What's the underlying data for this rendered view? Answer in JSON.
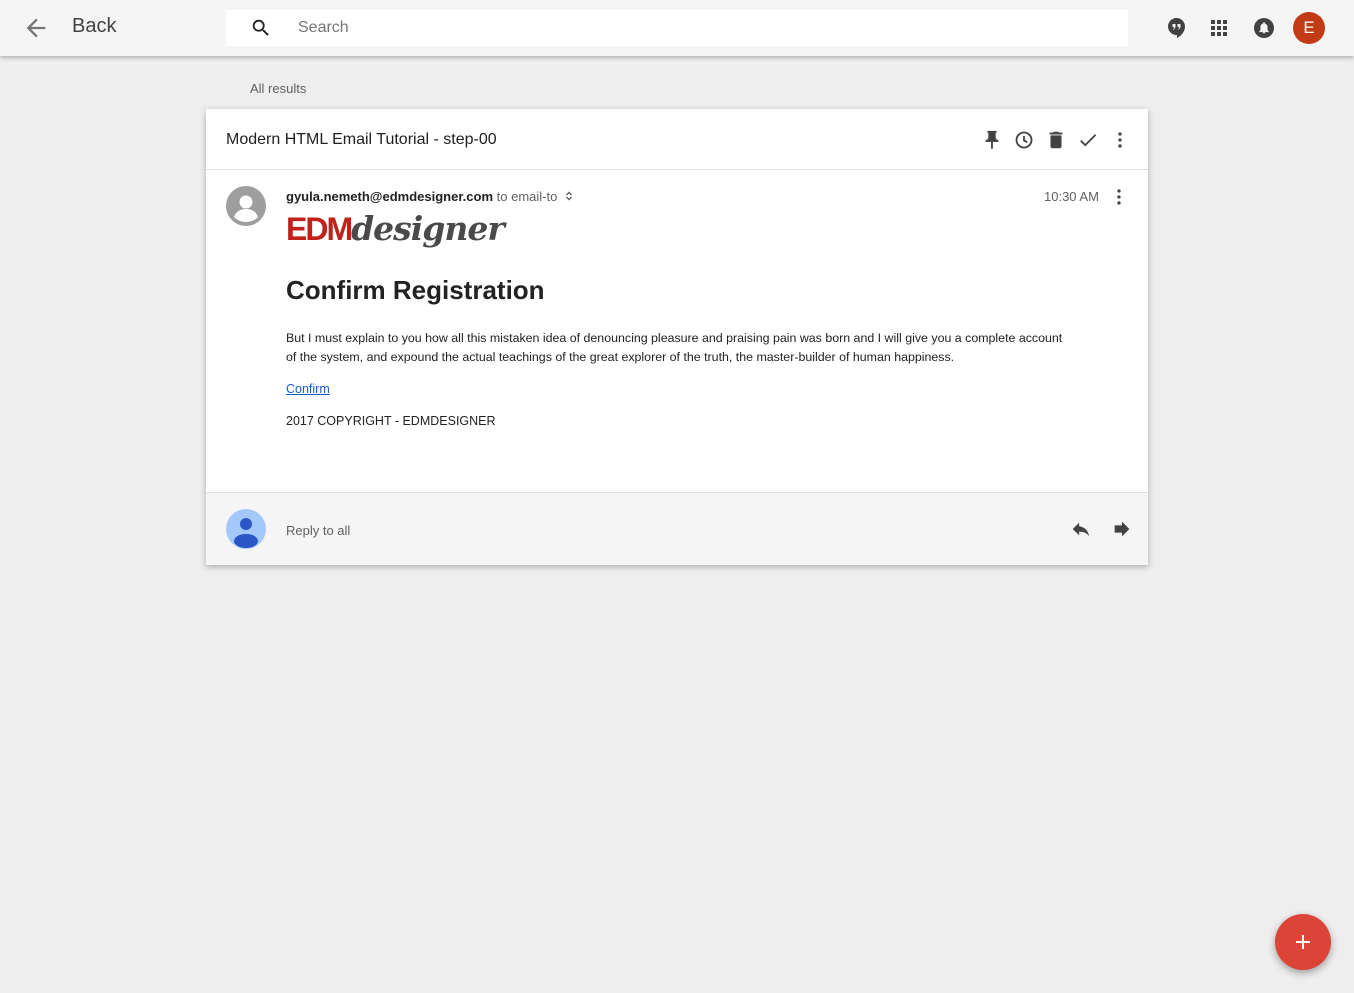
{
  "topbar": {
    "back_label": "Back",
    "search_placeholder": "Search",
    "account_initial": "E",
    "icons": [
      "arrow-back-icon",
      "search-icon",
      "hangouts-icon",
      "apps-grid-icon",
      "notifications-icon"
    ]
  },
  "breadcrumb": {
    "label": "All results"
  },
  "message": {
    "subject": "Modern HTML Email Tutorial - step-00",
    "header_icons": [
      "pin-icon",
      "snooze-clock-icon",
      "trash-icon",
      "done-check-icon",
      "more-vert-icon"
    ],
    "sender_email": "gyula.nemeth@edmdesigner.com",
    "recipient_text": "to email-to",
    "time": "10:30 AM",
    "logo_part1": "EDM",
    "logo_part2": "designer",
    "heading": "Confirm Registration",
    "body": "But I must explain to you how all this mistaken idea of denouncing pleasure and praising pain was born and I will give you a complete account of the system, and expound the actual teachings of the great explorer of the truth, the master-builder of human happiness.",
    "link_text": "Confirm",
    "copyright": "2017 COPYRIGHT - EDMDESIGNER"
  },
  "reply": {
    "label": "Reply to all",
    "icons": [
      "reply-icon",
      "forward-icon"
    ]
  },
  "fab": {
    "icon": "plus-icon"
  },
  "colors": {
    "accent_red": "#db4437",
    "avatar_red": "#c23b16",
    "logo_red": "#c0211a",
    "link_blue": "#1a5cc8",
    "background": "#eeeeee"
  }
}
